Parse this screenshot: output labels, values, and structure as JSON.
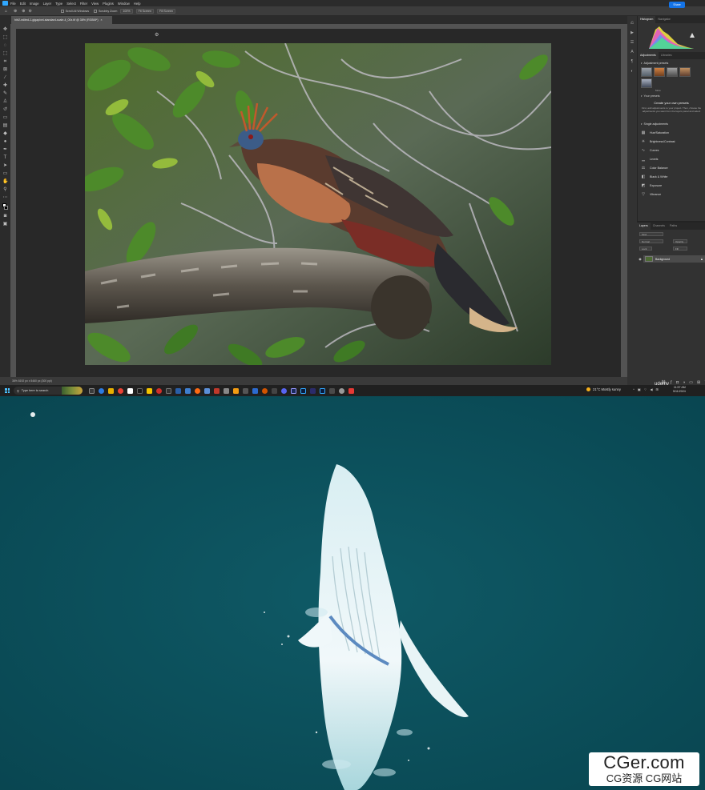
{
  "menubar": {
    "items": [
      "File",
      "Edit",
      "Image",
      "Layer",
      "Type",
      "Select",
      "Filter",
      "View",
      "Plugins",
      "Window",
      "Help"
    ]
  },
  "options": {
    "scroll_all": "Scroll All Windows",
    "scrubby_zoom": "Scrubby Zoom",
    "zoom_100": "100%",
    "fit_screen": "Fit Screen",
    "fill_screen": "Fill Screen",
    "share_label": "Share"
  },
  "document": {
    "tab_title": "hitr2-edited-1-gigapixel-standard-scale-4_00x.tif @ 38% (RGB/8*)",
    "status": "38%     8192 px x 5460 px (300 ppi)"
  },
  "panels": {
    "top_tabs": [
      "Histogram",
      "Navigator"
    ],
    "adj_tabs": [
      "Adjustments",
      "Libraries"
    ],
    "adjustment_presets_label": "Adjustment presets",
    "more_label": "More",
    "your_presets_label": "Your presets",
    "create_title": "Create your own presets",
    "create_desc": "First, add adjustments to your project. Then, choose the adjustments you want from the layers panel and select",
    "single_adjustments_label": "Single adjustments",
    "adjustments": [
      "Hue/Saturation",
      "Brightness/Contrast",
      "Curves",
      "Levels",
      "Color Balance",
      "Black & White",
      "Exposure",
      "Vibrance"
    ],
    "layer_tabs": [
      "Layers",
      "Channels",
      "Paths"
    ],
    "kind_label": "Kind",
    "normal_label": "Normal",
    "opacity_label": "Opacity",
    "lock_label": "Lock",
    "fill_label": "Fill",
    "layer_name": "Background"
  },
  "taskbar": {
    "search_placeholder": "Type here to search",
    "weather": "21°C  Mostly sunny",
    "time": "11:57 AM",
    "date": "5/11/2024",
    "watermark_app": "udemy"
  },
  "watermark": {
    "line1": "CGer.com",
    "line2": "CG资源  CG网站"
  },
  "colors": {
    "accent": "#31a8ff",
    "share": "#1473e6",
    "sea": "#0b4e59"
  }
}
